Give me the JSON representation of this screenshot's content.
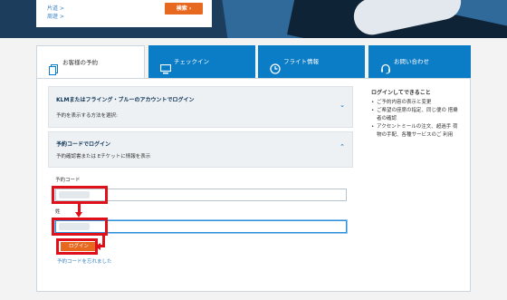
{
  "hero": {
    "link_one_way": "片道 >",
    "link_multi_city": "周遊 >",
    "search_label": "検索",
    "search_chevron": "›"
  },
  "tabs": [
    {
      "label": "お客様の予約",
      "icon": "booking-icon",
      "active": true
    },
    {
      "label": "チェックイン",
      "icon": "monitor-icon",
      "active": false
    },
    {
      "label": "フライト情報",
      "icon": "clock-icon",
      "active": false
    },
    {
      "label": "お問い合わせ",
      "icon": "headset-icon",
      "active": false
    }
  ],
  "accordion_klm": {
    "title": "KLMまたはフライング・ブルーのアカウントでログイン",
    "subtitle": "予約を表示する方法を選択:",
    "chevron": "⌄"
  },
  "accordion_code": {
    "title": "予約コードでログイン",
    "subtitle": "予約確認書または Eチケットに情報を表示",
    "chevron": "⌃"
  },
  "form": {
    "booking_code_label": "予約コード",
    "booking_code_value": "",
    "last_name_label": "姓",
    "last_name_value": "",
    "login_label": "ログイン",
    "forgot_link": "予約コードを忘れました"
  },
  "sidebar": {
    "title": "ログインしてできること",
    "items": [
      "ご予約内容の表示と変更",
      "ご希望の座席の指定、同じ便の 搭乗者の確認",
      "アクセントミールの注文、超過手 荷物の手配、各種サービスのご 利用"
    ]
  },
  "colors": {
    "brand_blue": "#0b7dc6",
    "accent_orange": "#e7681f",
    "annotation_red": "#e0101a"
  }
}
